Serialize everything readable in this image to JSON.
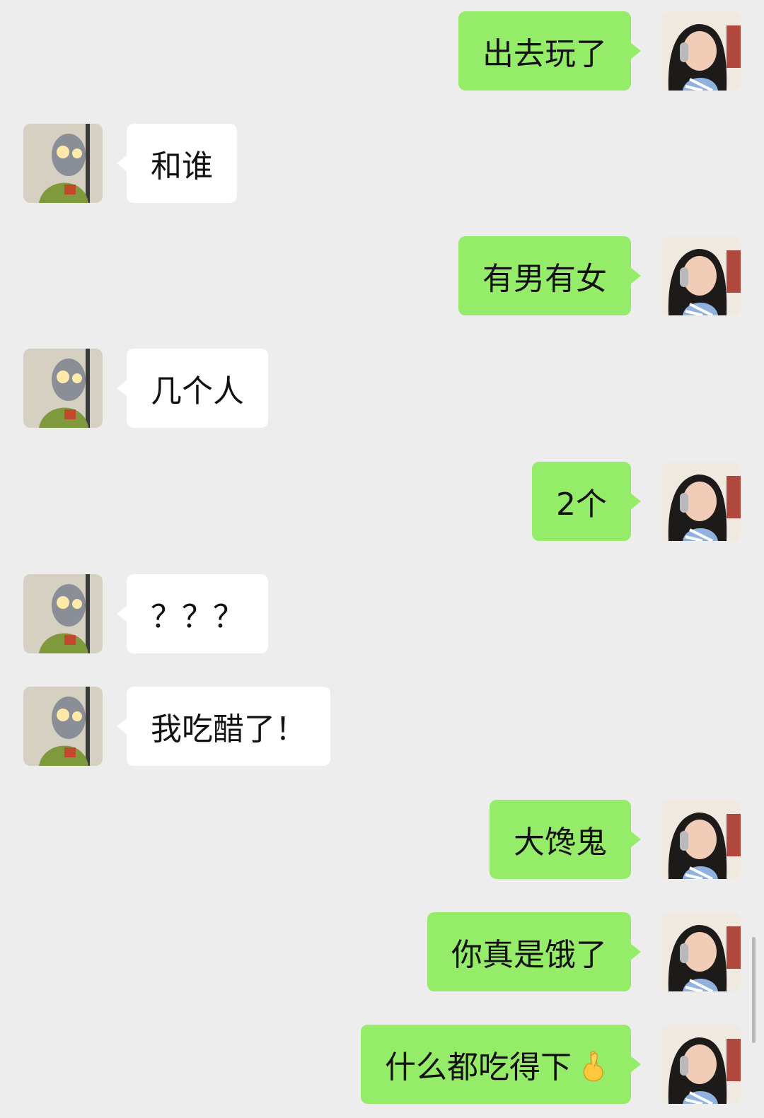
{
  "colors": {
    "background": "#ededed",
    "self_bubble": "#95ec69",
    "other_bubble": "#ffffff"
  },
  "messages": [
    {
      "side": "right",
      "text": "出去玩了"
    },
    {
      "side": "left",
      "text": "和谁"
    },
    {
      "side": "right",
      "text": "有男有女"
    },
    {
      "side": "left",
      "text": "几个人"
    },
    {
      "side": "right",
      "text": "2个"
    },
    {
      "side": "left",
      "text": "？？？"
    },
    {
      "side": "left",
      "text": "我吃醋了！"
    },
    {
      "side": "right",
      "text": "大馋鬼"
    },
    {
      "side": "right",
      "text": "你真是饿了"
    },
    {
      "side": "right",
      "text": "什么都吃得下",
      "emoji": "crossed-fingers-emoji"
    }
  ]
}
